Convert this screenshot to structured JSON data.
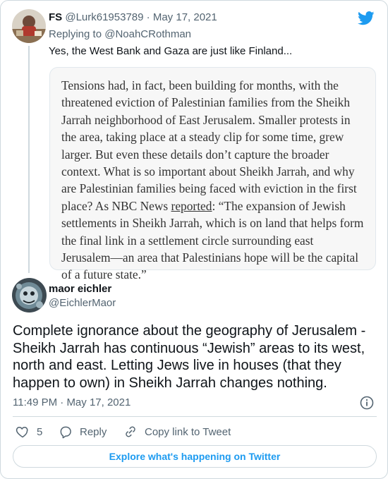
{
  "reply_tweet": {
    "display_name": "FS",
    "handle": "@Lurk61953789",
    "separator": "·",
    "date": "May 17, 2021",
    "replying_prefix": "Replying to",
    "replying_to": "@NoahCRothman",
    "text": "Yes, the West Bank and Gaza are just like Finland...",
    "quote_image": {
      "part1": "Tensions had, in fact, been building for months, with the threatened eviction of Palestinian families from the Sheikh Jarrah neighborhood of East Jerusalem. Smaller protests in the area, taking place at a steady clip for some time, grew larger. But even these details don’t capture the broader context. What is so important about Sheikh Jarrah, and why are Palestinian families being faced with eviction in the first place? As NBC News ",
      "link": "reported",
      "part2": ": “The expansion of Jewish settlements in Sheikh Jarrah, which is on land that helps form the final link in a settlement circle surrounding east Jerusalem—an area that Palestinians hope will be the capital of a future state.”"
    }
  },
  "main_tweet": {
    "display_name": "maor eichler",
    "handle": "@EichlerMaor",
    "text": "Complete ignorance about the geography of Jerusalem - Sheikh Jarrah has continuous “Jewish” areas  to its west, north and east. Letting Jews live in houses (that they happen to own) in Sheikh Jarrah changes nothing.",
    "time": "11:49 PM",
    "separator": "·",
    "date": "May 17, 2021"
  },
  "actions": {
    "like_count": "5",
    "reply_label": "Reply",
    "copy_label": "Copy link to Tweet"
  },
  "explore_label": "Explore what's happening on Twitter",
  "colors": {
    "twitter_blue": "#1d9bf0",
    "secondary_text": "#536471",
    "border": "#cfd9de",
    "quote_bg": "#f7f7f7"
  },
  "icons": [
    "twitter-bird-icon",
    "info-icon",
    "heart-icon",
    "reply-icon",
    "link-icon"
  ]
}
